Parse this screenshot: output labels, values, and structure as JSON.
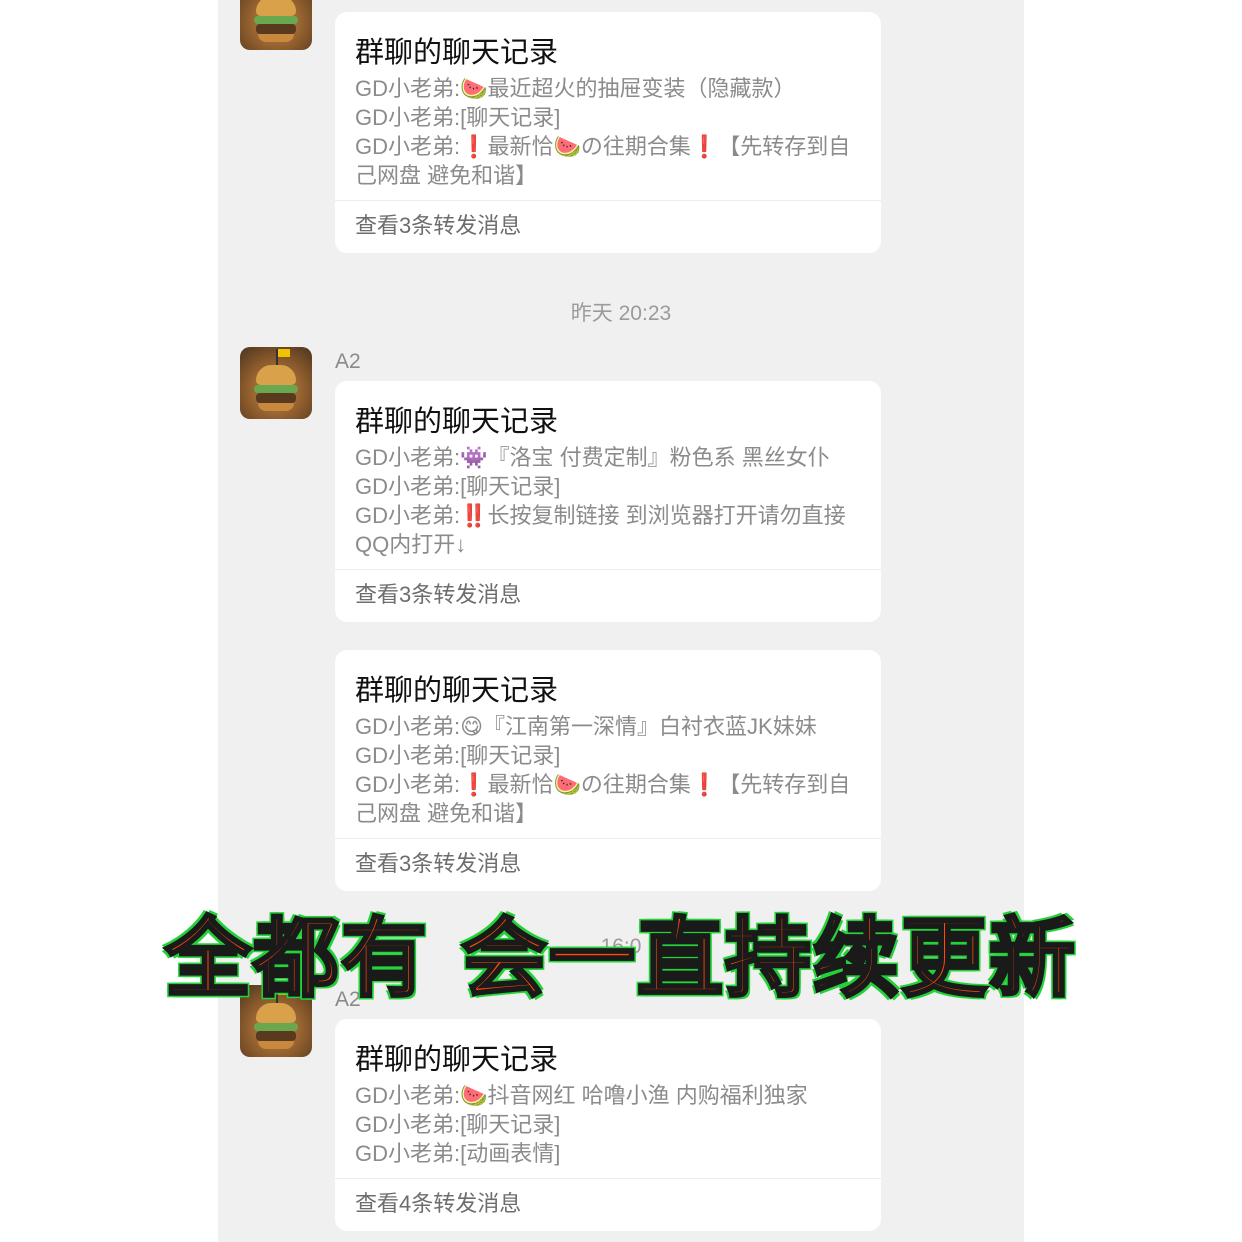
{
  "chat": {
    "messages": [
      {
        "sender": "",
        "cards": [
          {
            "title": "群聊的聊天记录",
            "lines": [
              "GD小老弟:🍉最近超火的抽屉变装（隐藏款）",
              "GD小老弟:[聊天记录]",
              "GD小老弟:❗最新恰🍉の往期合集❗【先转存到自己网盘 避免和谐】"
            ],
            "footer": "查看3条转发消息"
          }
        ]
      },
      {
        "timestamp": "昨天 20:23",
        "sender": "A2",
        "cards": [
          {
            "title": "群聊的聊天记录",
            "lines": [
              "GD小老弟:👾『洛宝 付费定制』粉色系 黑丝女仆",
              "GD小老弟:[聊天记录]",
              "GD小老弟:‼️长按复制链接 到浏览器打开请勿直接QQ内打开↓"
            ],
            "footer": "查看3条转发消息"
          },
          {
            "title": "群聊的聊天记录",
            "lines": [
              "GD小老弟:😋『江南第一深情』白衬衣蓝JK妹妹",
              "GD小老弟:[聊天记录]",
              "GD小老弟:❗最新恰🍉の往期合集❗【先转存到自己网盘 避免和谐】"
            ],
            "footer": "查看3条转发消息"
          }
        ]
      },
      {
        "timestamp": "16:0",
        "sender": "A2",
        "cards": [
          {
            "title": "群聊的聊天记录",
            "lines": [
              "GD小老弟:🍉抖音网红 哈噜小渔 内购福利独家",
              "GD小老弟:[聊天记录]",
              "GD小老弟:[动画表情]"
            ],
            "footer": "查看4条转发消息"
          }
        ]
      }
    ]
  },
  "overlay": {
    "text": "全都有 会一直持续更新"
  }
}
